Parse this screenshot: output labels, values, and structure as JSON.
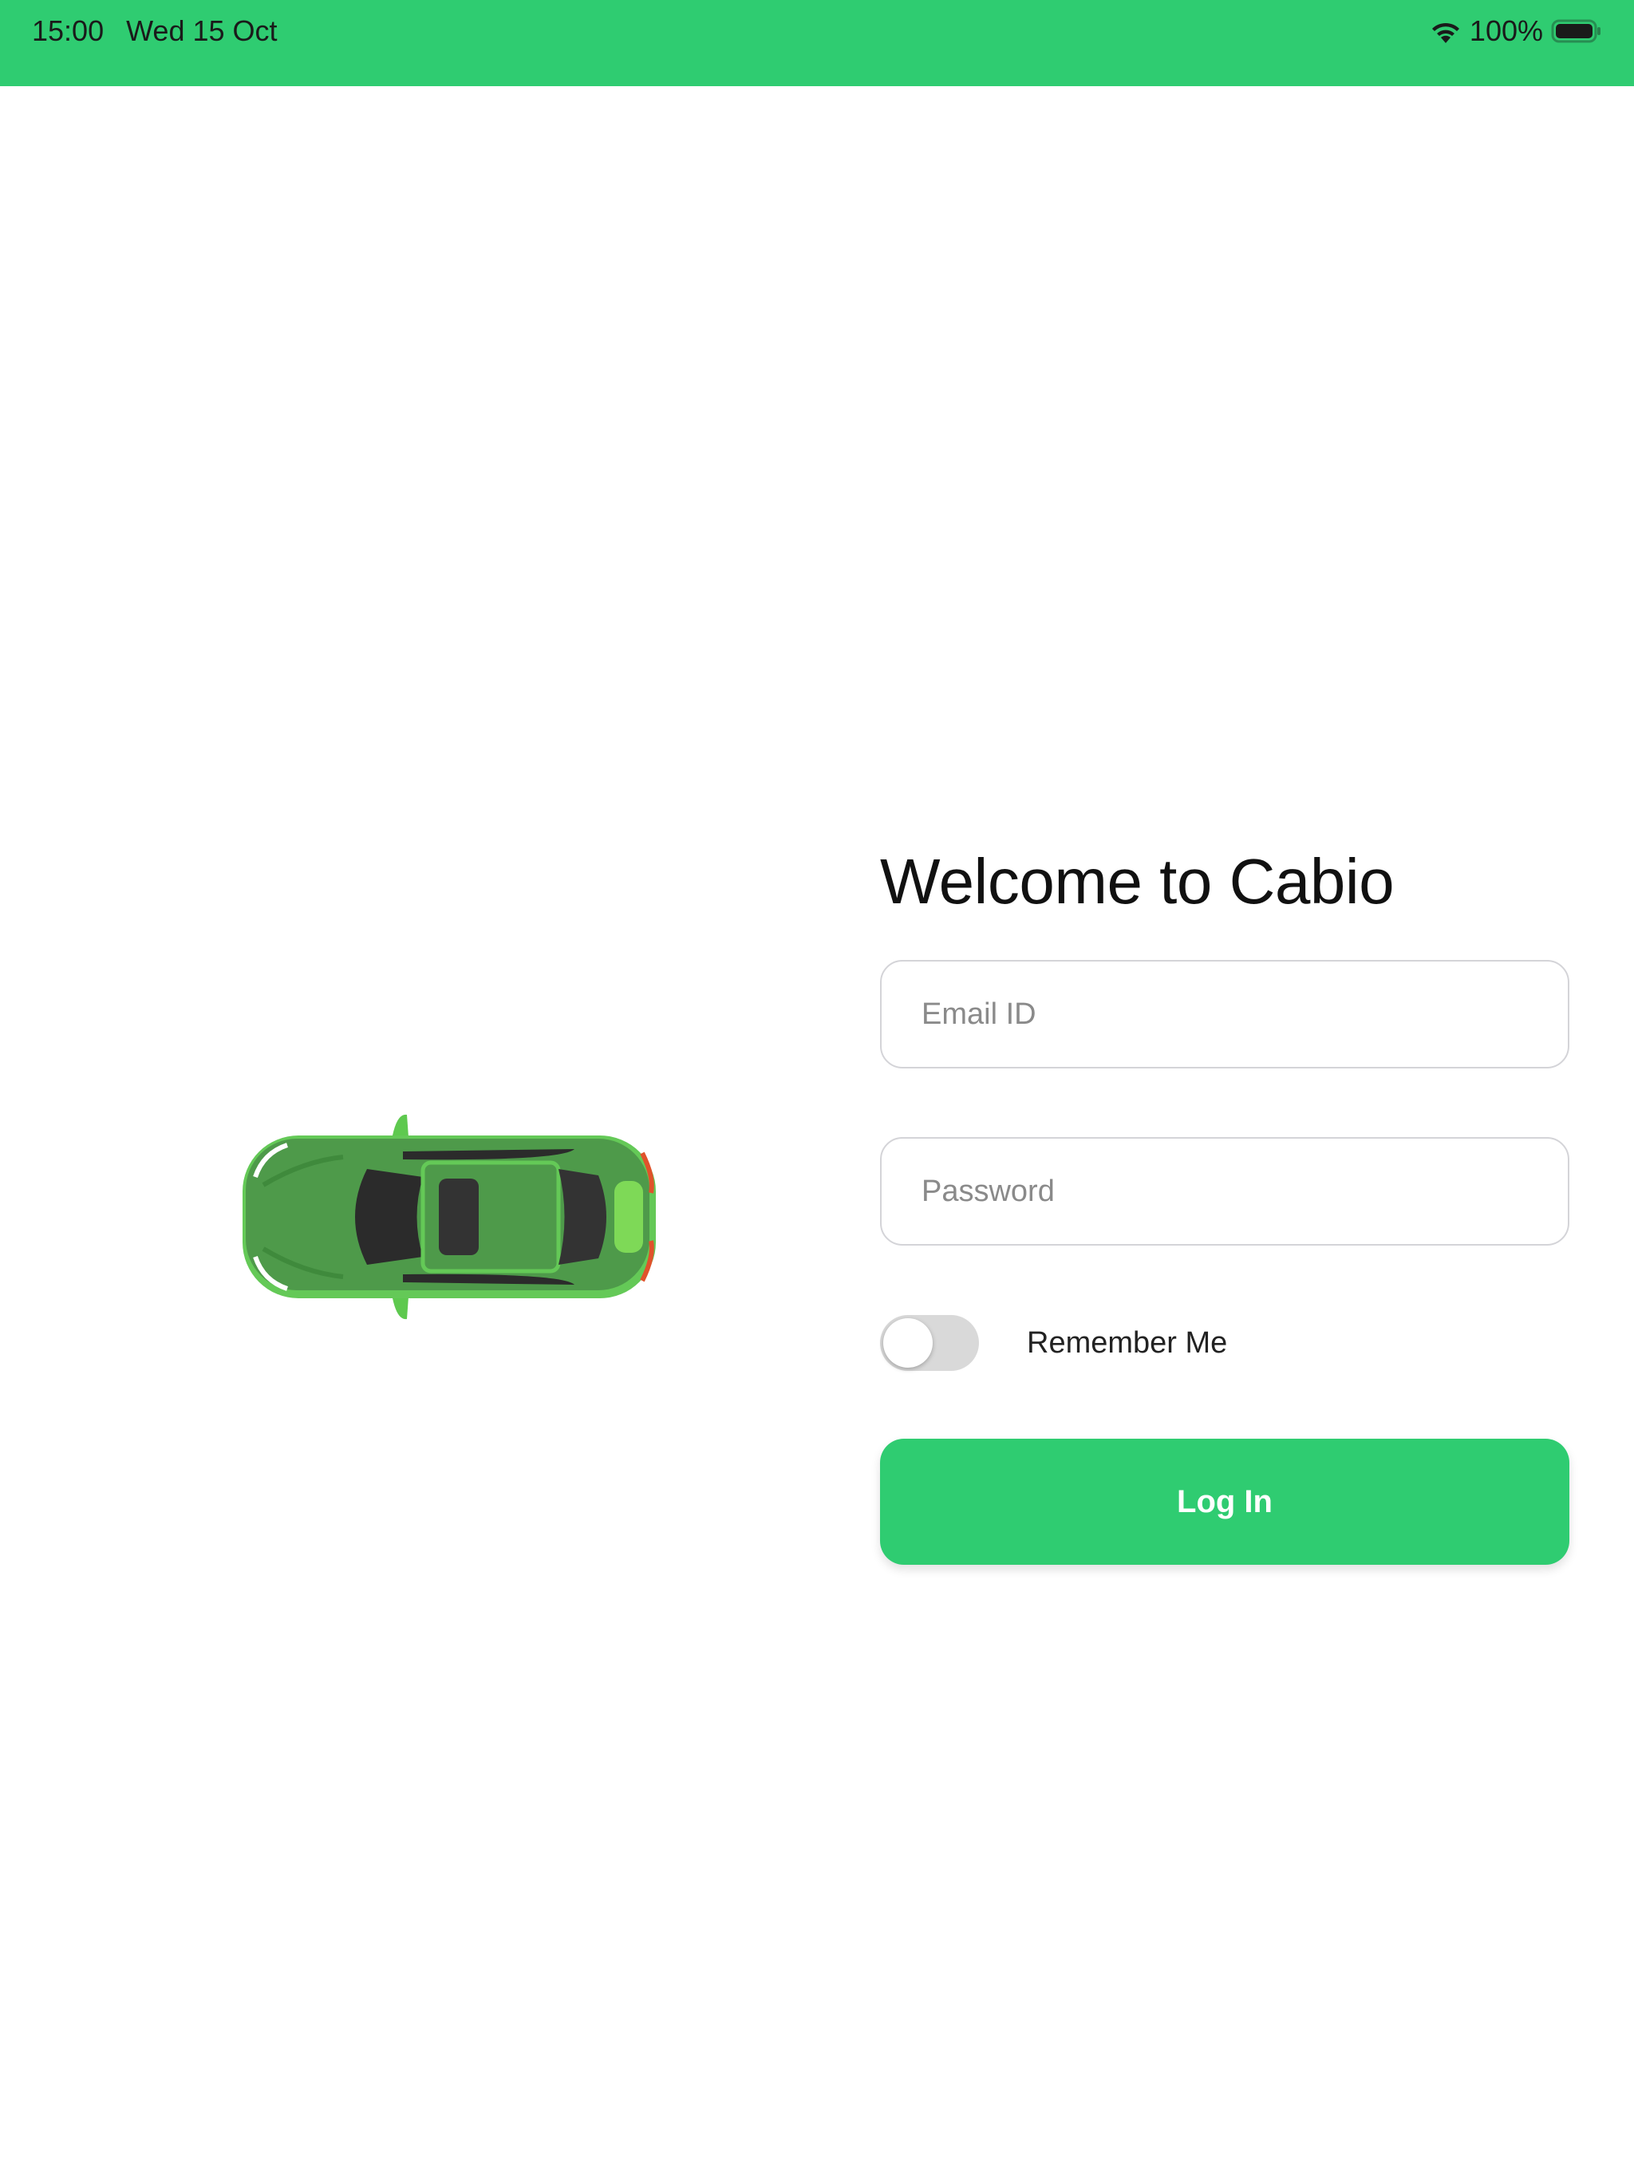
{
  "status_bar": {
    "time": "15:00",
    "date": "Wed 15 Oct",
    "battery": "100%",
    "background_color": "#2fcc71"
  },
  "login": {
    "title": "Welcome to Cabio",
    "email_placeholder": "Email ID",
    "password_placeholder": "Password",
    "remember_label": "Remember Me",
    "remember_on": false,
    "button_label": "Log In",
    "accent_color": "#2fcc71"
  },
  "illustration": {
    "icon": "car-top-view-icon",
    "car_color": "#4e9a4a"
  }
}
